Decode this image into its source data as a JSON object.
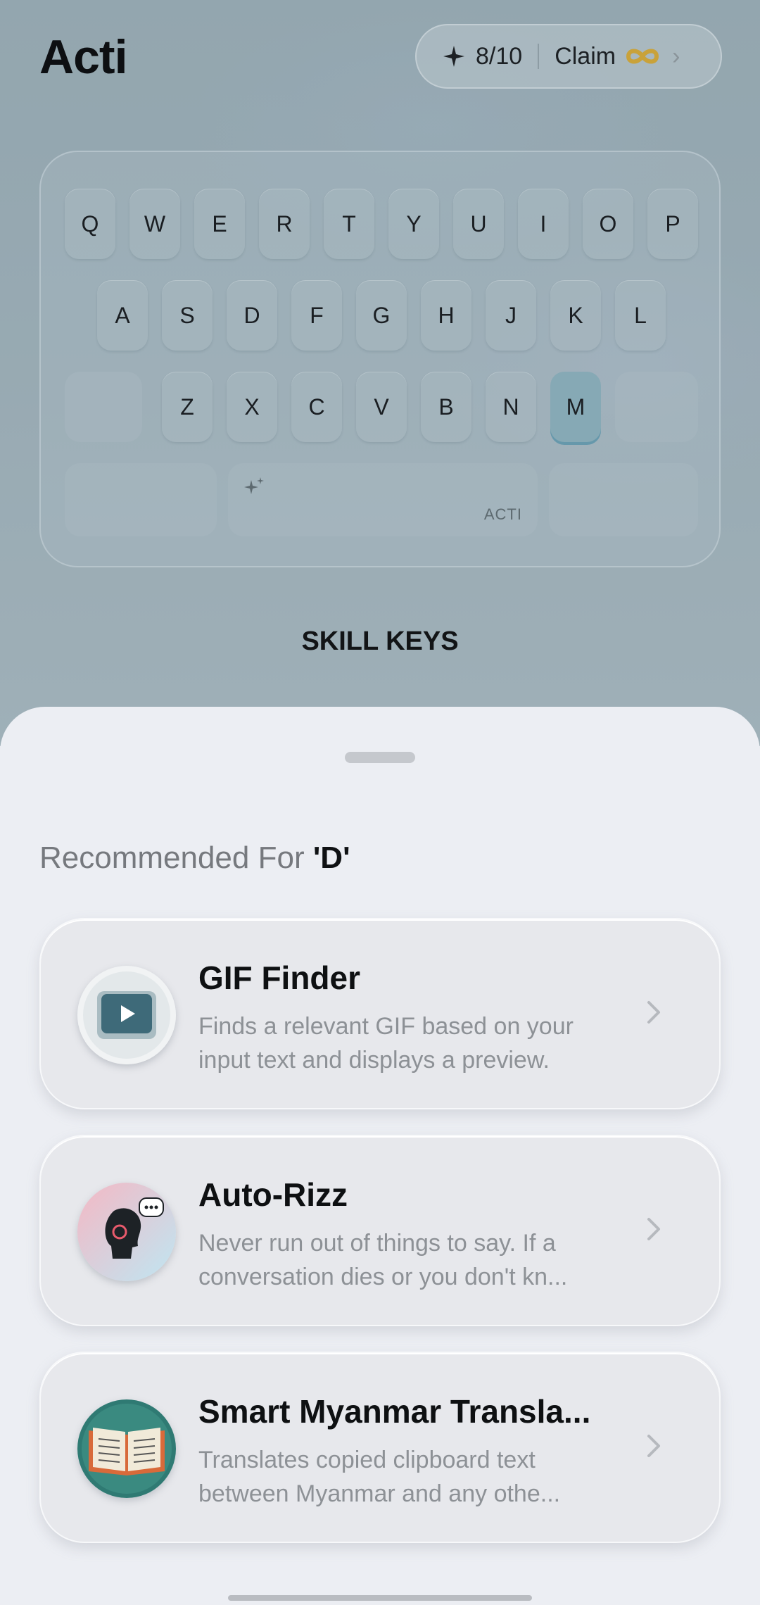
{
  "header": {
    "app_title": "Acti",
    "credits": "8/10",
    "claim_label": "Claim"
  },
  "keyboard": {
    "row1": [
      "Q",
      "W",
      "E",
      "R",
      "T",
      "Y",
      "U",
      "I",
      "O",
      "P"
    ],
    "row2": [
      "A",
      "S",
      "D",
      "F",
      "G",
      "H",
      "J",
      "K",
      "L"
    ],
    "row3": [
      "Z",
      "X",
      "C",
      "V",
      "B",
      "N",
      "M"
    ],
    "highlighted_key": "M",
    "space_label": "ACTI"
  },
  "skill_keys_title": "SKILL KEYS",
  "sheet": {
    "title_prefix": "Recommended For ",
    "title_letter": "'D'",
    "cards": [
      {
        "title": "GIF Finder",
        "desc_line1": "Finds a relevant GIF based on your",
        "desc_line2": "input text and displays a preview.",
        "icon": "play-video-icon"
      },
      {
        "title": "Auto-Rizz",
        "desc_line1": "Never run out of things to say. If a",
        "desc_line2": "conversation dies or you don't kn...",
        "icon": "chat-head-icon"
      },
      {
        "title": "Smart Myanmar Transla...",
        "desc_line1": "Translates copied clipboard text",
        "desc_line2": "between Myanmar and any othe...",
        "icon": "open-book-icon"
      }
    ]
  },
  "colors": {
    "accent_gold": "#c9a23a",
    "active_key": "#86a9b5"
  }
}
